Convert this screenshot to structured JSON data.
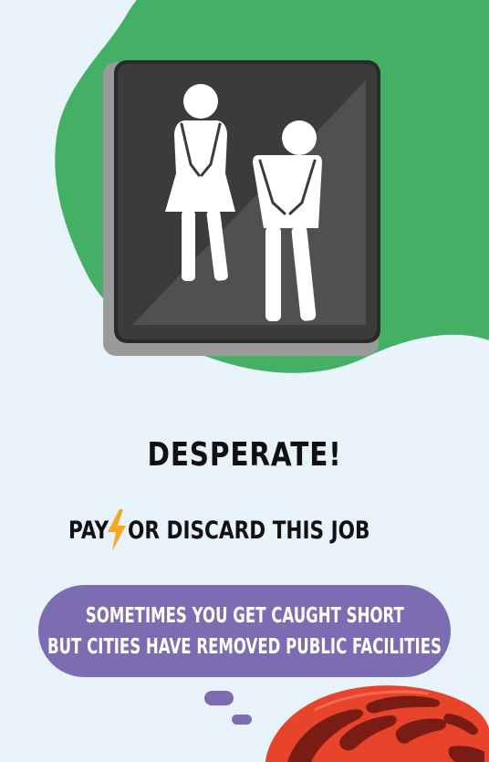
{
  "card": {
    "title": "DESPERATE!",
    "cost": {
      "pay_label": "PAY",
      "currency_icon": "lightning-bolt-icon",
      "discard_label": "OR DISCARD THIS JOB"
    },
    "flavor_line_1": "SOMETIMES YOU GET CAUGHT SHORT",
    "flavor_line_2": "BUT CITIES HAVE REMOVED PUBLIC FACILITIES"
  },
  "colors": {
    "background": "#e8f3fb",
    "green_blob": "#44b066",
    "sign_dark": "#3c3c3c",
    "bubble_purple": "#7c6db2",
    "bolt_orange": "#f7a823",
    "helmet_red": "#e8442c"
  },
  "icons": [
    "restroom-sign-icon",
    "lightning-bolt-icon",
    "bike-helmet-icon"
  ]
}
